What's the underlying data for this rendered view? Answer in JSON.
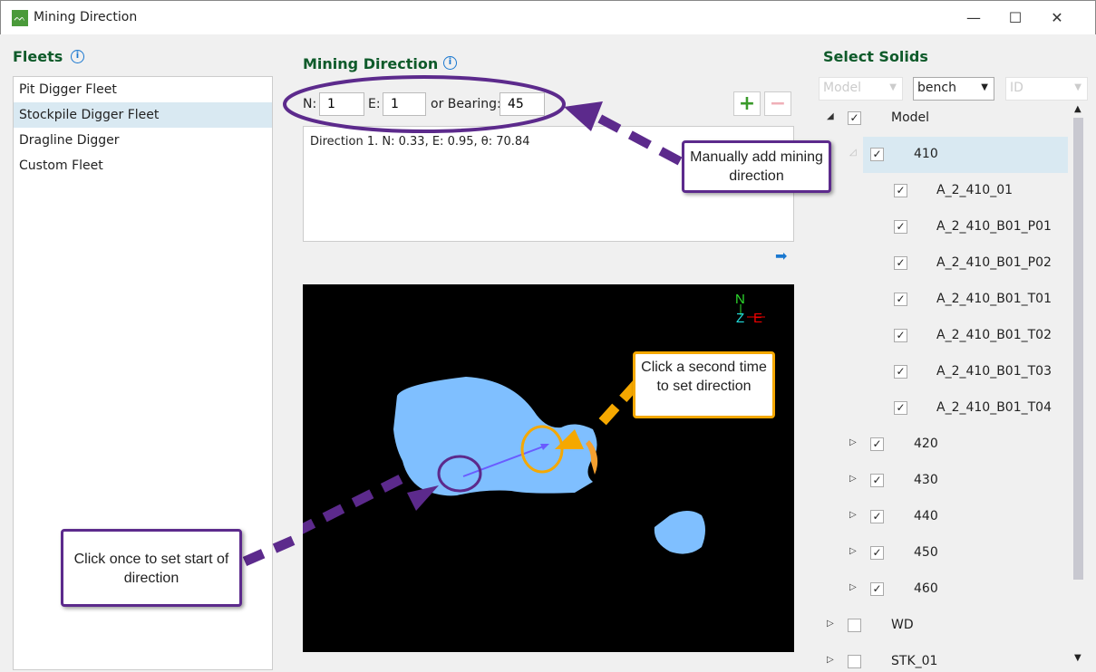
{
  "window": {
    "title": "Mining Direction",
    "minimize": "—",
    "maximize": "☐",
    "close": "✕"
  },
  "fleets": {
    "heading": "Fleets",
    "info": "i",
    "items": [
      "Pit Digger Fleet",
      "Stockpile Digger Fleet",
      "Dragline Digger",
      "Custom Fleet"
    ],
    "selected_index": 1
  },
  "mining_direction": {
    "heading": "Mining Direction",
    "info": "i",
    "n_label": "N:",
    "n_value": "1",
    "e_label": "E:",
    "e_value": "1",
    "bearing_label": "or Bearing:",
    "bearing_value": "45",
    "add": "+",
    "remove": "−",
    "directions": [
      "Direction 1. N: 0.33, E: 0.95, θ: 70.84"
    ]
  },
  "viewer": {
    "axis_n": "N",
    "axis_z": "Z",
    "axis_e": "E"
  },
  "solids": {
    "heading": "Select Solids",
    "filter1": "Model",
    "filter2": "bench",
    "filter3": "ID",
    "tree": [
      {
        "label": "Model",
        "level": 0,
        "expander": "◢",
        "checked": true
      },
      {
        "label": "410",
        "level": 1,
        "expander": "◿",
        "checked": true,
        "selected": true
      },
      {
        "label": "A_2_410_01",
        "level": 2,
        "checked": true
      },
      {
        "label": "A_2_410_B01_P01",
        "level": 2,
        "checked": true
      },
      {
        "label": "A_2_410_B01_P02",
        "level": 2,
        "checked": true
      },
      {
        "label": "A_2_410_B01_T01",
        "level": 2,
        "checked": true
      },
      {
        "label": "A_2_410_B01_T02",
        "level": 2,
        "checked": true
      },
      {
        "label": "A_2_410_B01_T03",
        "level": 2,
        "checked": true
      },
      {
        "label": "A_2_410_B01_T04",
        "level": 2,
        "checked": true
      },
      {
        "label": "420",
        "level": 1,
        "expander": "▷",
        "checked": true
      },
      {
        "label": "430",
        "level": 1,
        "expander": "▷",
        "checked": true
      },
      {
        "label": "440",
        "level": 1,
        "expander": "▷",
        "checked": true
      },
      {
        "label": "450",
        "level": 1,
        "expander": "▷",
        "checked": true
      },
      {
        "label": "460",
        "level": 1,
        "expander": "▷",
        "checked": true
      },
      {
        "label": "WD",
        "level": 0,
        "expander": "▷",
        "checked": false
      },
      {
        "label": "STK_01",
        "level": 0,
        "expander": "▷",
        "checked": false
      }
    ]
  },
  "callouts": {
    "manual": "Manually add mining direction",
    "second": "Click a second time to set direction",
    "first": "Click once to set start of direction"
  },
  "colors": {
    "heading": "#0e5a2a",
    "purple": "#5c2a8c",
    "orange": "#f5a800",
    "solid": "#7fbfff"
  }
}
